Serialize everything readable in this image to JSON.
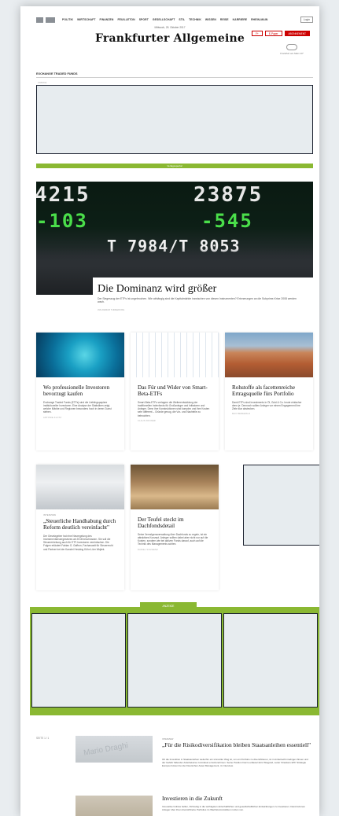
{
  "nav": {
    "items": [
      "POLITIK",
      "WIRTSCHAFT",
      "FINANZEN",
      "FEUILLETON",
      "SPORT",
      "GESELLSCHAFT",
      "STIL",
      "TECHNIK",
      "WISSEN",
      "REISE",
      "KARRIERE",
      "RHEIN-MAIN"
    ],
    "login": "Login"
  },
  "header": {
    "date": "Mittwoch, 25. Oktober 2017",
    "masthead": "Frankfurter Allgemeine",
    "btn_fplus": "F+",
    "btn_epaper": "E-Paper",
    "btn_subscribe": "ABONNEMENT",
    "weather": "Frankfurt am Main 10°"
  },
  "section": {
    "title": "EXCHANGE TRADED FUNDS",
    "ad_label": "ANZEIGE",
    "green_bar": "Verlagsspezial"
  },
  "hero": {
    "ticker_line1": "4215",
    "ticker_line1b": "23875",
    "ticker_line2": "-103",
    "ticker_line2b": "-545",
    "ticker_line3": "T  7984/T  8053",
    "title": "Die Dominanz wird größer",
    "teaser": "Der Siegeszug der ETFs ist ungebrochen. Wie abhängig sind die Kapitalmärkte inzwischen von diesen Instrumenten? Erinnerungen an die Subprime-Krise 2008 werden wach.",
    "author": "WALDEMAR THREERCRE"
  },
  "cards_row1": [
    {
      "title": "Wo professionelle Investoren bevorzugt kaufen",
      "text": "Exchange Traded Funds (ETFs) sind die Lieblingspapiere institutioneller Investoren. Eine Analyse der Statistiken zeigt, welche Märkte und Regionen besonders hoch in deren Gunst stehen.",
      "author": "ANTONIE KLOTZ"
    },
    {
      "title": "Das Für und Wider von Smart-Beta-ETFs",
      "text": "Smart-Beta-ETFs verlagern die Weiterentwicklung der traditionellen Indexfonds für Großanleger und Initiatoren und Anleger. Denn ihre Konstruktionen sind komplex und ihre Kosten sehr different – Gründe genug, die Vor- und Nachteile zu beleuchten.",
      "author": "CLAUS KRONER"
    },
    {
      "title": "Rohstoffe als facettenreiche Ertragsquelle fürs Portfolio",
      "text": "Dank ETFs sind Investments in Öl, Gold & Co. heute einfacher denn je. Dennoch sollten Anleger vor einem Engagement ihre Ziele klar abstecken.",
      "author": "MAX BEREWALD"
    }
  ],
  "cards_row2": [
    {
      "tag": "INTERVIEW",
      "title": "„Steuerliche Handhabung durch Reform deutlich vereinfacht\"",
      "text": "Der Gesetzgeber hat eine Neuregelung des Investmentsteuergesetzes ab 2018 beschlossen. Sie soll die Steuererhebung auch für ETF-Investoren vereinfachen. Die Folgen erläutert Fabian G. Gaffron, Fachanwalt für Steuerrecht und Partner bei der Kanzlei Heuking Kühn Lüer Wojtek.",
      "author": ""
    },
    {
      "tag": "",
      "title": "Der Teufel steckt im Dachfondsdetail",
      "text": "Seine Vermögensverwaltung über Dachfonds zu regeln, ist ein attraktives Konzept. Anleger sollten dabei aber nicht nur auf die Kosten, sondern wie bei aktiven Fonds darauf, auch auf die Technik des Managements achten.",
      "author": "DANIEL SCHWENZ"
    }
  ],
  "anzeige": {
    "label": "ANZEIGE"
  },
  "list": {
    "pager": "SEITE   1 / 1",
    "items": [
      {
        "tag": "INTERVIEW",
        "title": "„Für die Risikodiversifikation bleiben Staatsanleihen essentiell\"",
        "text": "Ob die Investition in Staatsanleihen weiterhin ein sinnvoller Weg ist, um ein Portfolio zu diversifizieren, ist in Anbetracht niedriger Zinsen und der Gefahr fallender Anleihekurse zumindest ernstzunehmen. Seine Position hierzu erläutert Eric Wiegand, Leiter Xtrackers ETF Strategie Europa & Asien bei der Deutschen Asset Management, im Interview.",
        "thumb_text": "Mario Draghi"
      },
      {
        "tag": "",
        "title": "Investieren in die Zukunft",
        "text": "Innovative Indizes helfen, frühzeitig in die wichtigsten wirtschaftlichen und gesellschaftlichen Entwicklungen zu investieren. Damit können Anleger über ihren diversifizierte Portfolios im Wachstumsmärkten nutzen von."
      }
    ]
  }
}
